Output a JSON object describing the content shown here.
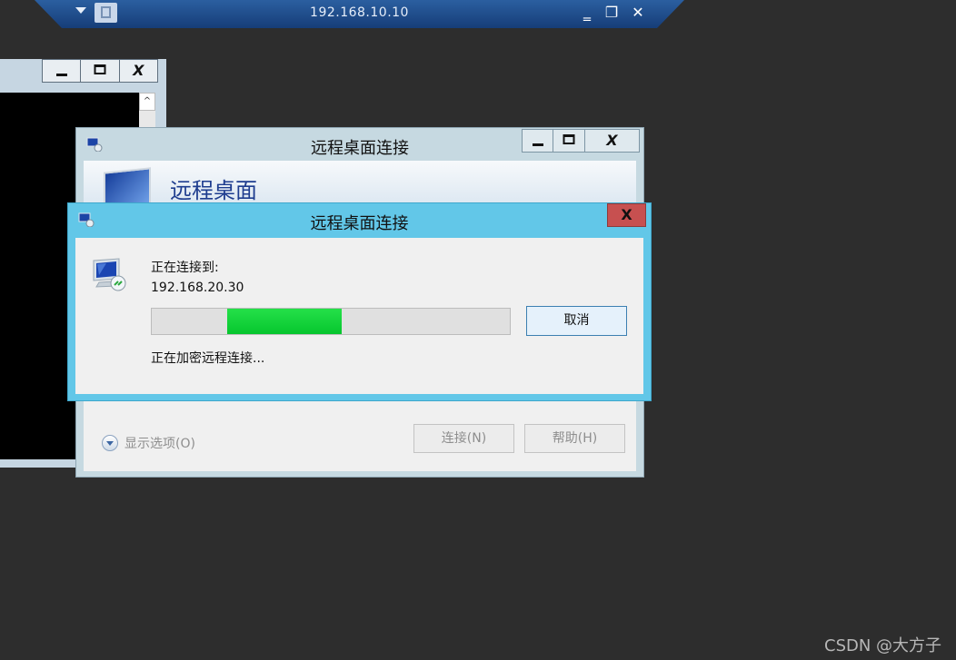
{
  "rdp_bar": {
    "title": "192.168.10.10",
    "minimize_glyph": "‗",
    "restore_glyph": "❐",
    "close_glyph": "✕"
  },
  "background_window": {
    "close_glyph": "X",
    "scroll_up_glyph": "^"
  },
  "main_dialog": {
    "title": "远程桌面连接",
    "banner_title": "远程桌面",
    "close_glyph": "X",
    "show_options": "显示选项(O)",
    "connect_button": "连接(N)",
    "help_button": "帮助(H)"
  },
  "connecting_dialog": {
    "title": "远程桌面连接",
    "close_glyph": "X",
    "connecting_label": "正在连接到:",
    "target_ip": "192.168.20.30",
    "progress": {
      "start": 0.21,
      "end": 0.53
    },
    "status_text": "正在加密远程连接...",
    "cancel_button": "取消",
    "colors": {
      "frame": "#62c7e8",
      "close": "#c75050",
      "progress_fill": "#06c62e"
    }
  },
  "watermark": "CSDN @大方子"
}
